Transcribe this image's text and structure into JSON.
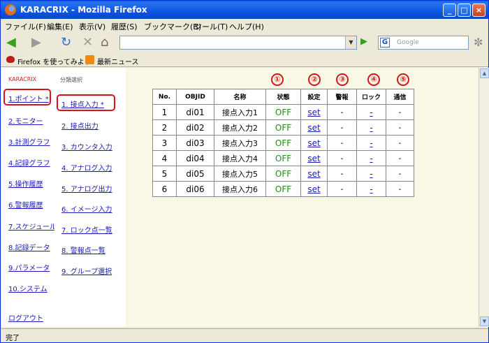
{
  "window": {
    "title": "KARACRIX - Mozilla Firefox",
    "min": "_",
    "max": "□",
    "close": "×"
  },
  "menu": [
    "ファイル(F)",
    "編集(E)",
    "表示(V)",
    "履歴(S)",
    "ブックマーク(B)",
    "ツール(T)",
    "ヘルプ(H)"
  ],
  "toolbar": {
    "search_placeholder": "Google",
    "back": "◀",
    "forward": "▶",
    "reload": "↻",
    "stop": "✕",
    "home": "⌂",
    "go": "▶",
    "engine": "G"
  },
  "bookmarks": [
    "Firefox を使ってみよう",
    "最新ニュース"
  ],
  "sidebar1": {
    "brand": "KARACRIX",
    "items": [
      "1.ポイント *",
      "2.モニター",
      "3.計測グラフ",
      "4.記録グラフ",
      "5.操作履歴",
      "6.警報履歴",
      "7.スケジュール",
      "8.記録データ",
      "9.パラメータ",
      "10.システム"
    ],
    "logout": "ログアウト"
  },
  "sidebar2": {
    "label": "分類選択",
    "items": [
      "1. 接点入力 *",
      "2. 接点出力",
      "3. カウンタ入力",
      "4. アナログ入力",
      "5. アナログ出力",
      "6. イメージ入力",
      "7. ロック点一覧",
      "8. 警報点一覧",
      "9. グループ選択"
    ]
  },
  "markers": [
    "①",
    "②",
    "③",
    "④",
    "⑤"
  ],
  "table": {
    "headers": [
      "No.",
      "OBJID",
      "名称",
      "状態",
      "設定",
      "警報",
      "ロック",
      "通信"
    ],
    "rows": [
      [
        "1",
        "di01",
        "接点入力1",
        "OFF",
        "set",
        "-",
        "-",
        "-"
      ],
      [
        "2",
        "di02",
        "接点入力2",
        "OFF",
        "set",
        "-",
        "-",
        "-"
      ],
      [
        "3",
        "di03",
        "接点入力3",
        "OFF",
        "set",
        "-",
        "-",
        "-"
      ],
      [
        "4",
        "di04",
        "接点入力4",
        "OFF",
        "set",
        "-",
        "-",
        "-"
      ],
      [
        "5",
        "di05",
        "接点入力5",
        "OFF",
        "set",
        "-",
        "-",
        "-"
      ],
      [
        "6",
        "di06",
        "接点入力6",
        "OFF",
        "set",
        "-",
        "-",
        "-"
      ]
    ]
  },
  "status": "完了",
  "colors": {
    "accent_red": "#d8131b",
    "link": "#1a1ab8",
    "off_green": "#1e8e12",
    "titlebar": "#0d56e0"
  }
}
